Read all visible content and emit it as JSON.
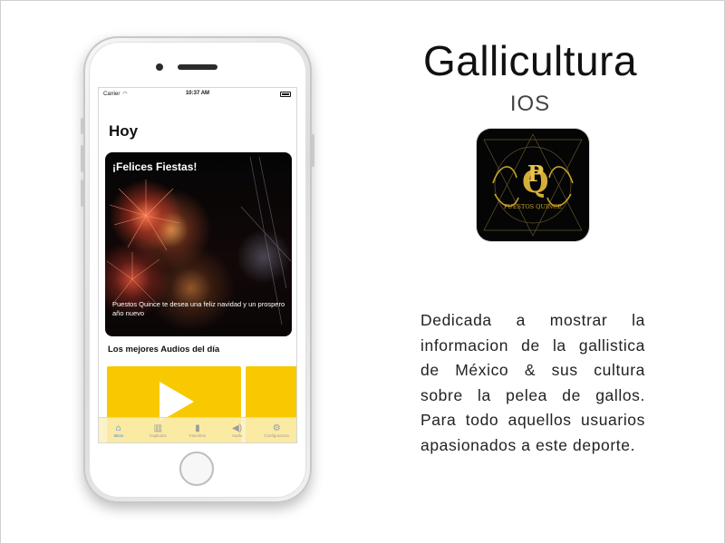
{
  "phone": {
    "status_bar": {
      "carrier": "Carrier",
      "time": "10:37 AM"
    },
    "screen": {
      "title": "Hoy",
      "feature_card": {
        "heading": "¡Felices Fiestas!",
        "text": "Puestos Quince te desea una feliz navidad y un prospero año nuevo"
      },
      "section_title": "Los mejores Audios del día"
    },
    "tab_bar": {
      "items": [
        {
          "label": "Inicio",
          "icon": "home-icon",
          "active": true
        },
        {
          "label": "Capitulos",
          "icon": "book-icon",
          "active": false
        },
        {
          "label": "Favoritos",
          "icon": "bookmark-icon",
          "active": false
        },
        {
          "label": "Audio",
          "icon": "speaker-icon",
          "active": false
        },
        {
          "label": "Configuracion",
          "icon": "gear-icon",
          "active": false
        }
      ]
    }
  },
  "promo": {
    "title": "Gallicultura",
    "platform": "IOS",
    "icon": {
      "name": "puestos-quince-logo-icon",
      "letters": "PQ",
      "caption": "PUESTOS QUINCE"
    },
    "description": "Dedicada a mostrar la informacion de la gallistica de México & sus cultura sobre la pelea de gallos. Para todo aquellos usuarios apasionados a este deporte."
  },
  "colors": {
    "accent": "#f8c900",
    "tab_active": "#2e7cf6",
    "gold": "#c9a227"
  }
}
